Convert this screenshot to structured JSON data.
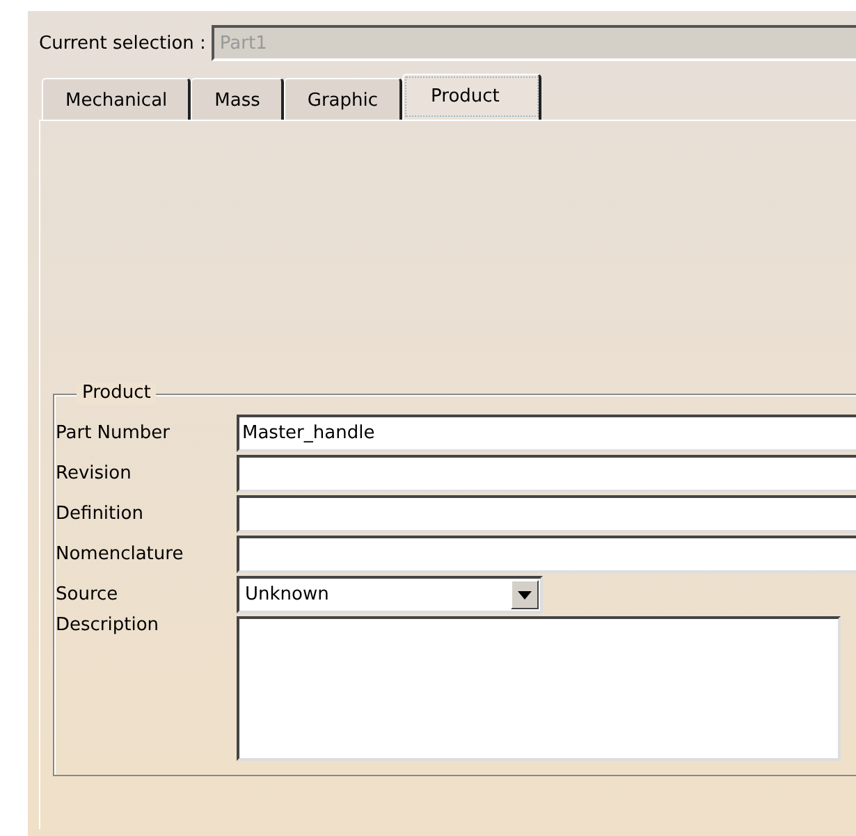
{
  "current_selection": {
    "label": "Current selection :",
    "value": "Part1",
    "disabled": true
  },
  "tabs": [
    {
      "label": "Mechanical",
      "selected": false
    },
    {
      "label": "Mass",
      "selected": false
    },
    {
      "label": "Graphic",
      "selected": false
    },
    {
      "label": "Product",
      "selected": true
    }
  ],
  "group": {
    "title": "Product",
    "fields": [
      {
        "kind": "text",
        "label": "Part Number",
        "value": "Master_handle"
      },
      {
        "kind": "text",
        "label": "Revision"
      },
      {
        "kind": "text",
        "label": "Definition"
      },
      {
        "kind": "text",
        "label": "Nomenclature"
      },
      {
        "kind": "dropdown",
        "label": "Source",
        "value": "Unknown"
      },
      {
        "kind": "textarea",
        "label": "Description"
      }
    ]
  }
}
